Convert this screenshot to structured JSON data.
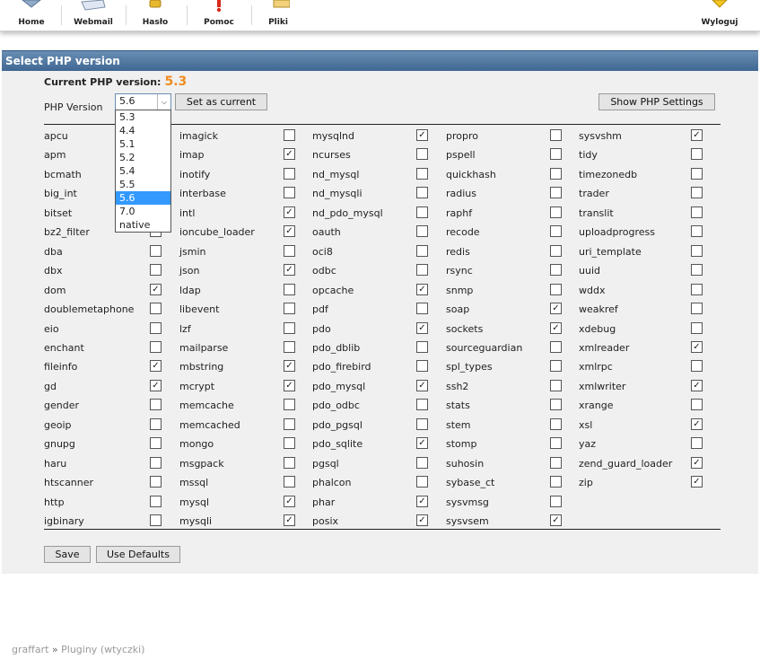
{
  "nav": {
    "items": [
      {
        "label": "Home",
        "icon": "home-icon"
      },
      {
        "label": "Webmail",
        "icon": "mail-icon"
      },
      {
        "label": "Hasło",
        "icon": "key-icon"
      },
      {
        "label": "Pomoc",
        "icon": "help-icon"
      },
      {
        "label": "Pliki",
        "icon": "files-icon"
      }
    ],
    "logout": "Wyloguj"
  },
  "panel": {
    "title": "Select PHP version",
    "current_label": "Current PHP version:",
    "current_value": "5.3",
    "version_label": "PHP Version",
    "selected_version": "5.6",
    "set_current": "Set as current",
    "show_settings": "Show PHP Settings",
    "save": "Save",
    "defaults": "Use Defaults"
  },
  "dropdown": {
    "options": [
      "5.3",
      "4.4",
      "5.1",
      "5.2",
      "5.4",
      "5.5",
      "5.6",
      "7.0",
      "native"
    ],
    "highlighted": "5.6"
  },
  "extensions": [
    [
      {
        "name": "apcu",
        "checked": false
      },
      {
        "name": "apm",
        "checked": false
      },
      {
        "name": "bcmath",
        "checked": false
      },
      {
        "name": "big_int",
        "checked": false
      },
      {
        "name": "bitset",
        "checked": false
      },
      {
        "name": "bz2_filter",
        "checked": false
      },
      {
        "name": "dba",
        "checked": false
      },
      {
        "name": "dbx",
        "checked": false
      },
      {
        "name": "dom",
        "checked": true
      },
      {
        "name": "doublemetaphone",
        "checked": false
      },
      {
        "name": "eio",
        "checked": false
      },
      {
        "name": "enchant",
        "checked": false
      },
      {
        "name": "fileinfo",
        "checked": true
      },
      {
        "name": "gd",
        "checked": true
      },
      {
        "name": "gender",
        "checked": false
      },
      {
        "name": "geoip",
        "checked": false
      },
      {
        "name": "gnupg",
        "checked": false
      },
      {
        "name": "haru",
        "checked": false
      },
      {
        "name": "htscanner",
        "checked": false
      },
      {
        "name": "http",
        "checked": false
      },
      {
        "name": "igbinary",
        "checked": false
      }
    ],
    [
      {
        "name": "imagick",
        "checked": false
      },
      {
        "name": "imap",
        "checked": true
      },
      {
        "name": "inotify",
        "checked": false
      },
      {
        "name": "interbase",
        "checked": false
      },
      {
        "name": "intl",
        "checked": true
      },
      {
        "name": "ioncube_loader",
        "checked": true
      },
      {
        "name": "jsmin",
        "checked": false
      },
      {
        "name": "json",
        "checked": true
      },
      {
        "name": "ldap",
        "checked": false
      },
      {
        "name": "libevent",
        "checked": false
      },
      {
        "name": "lzf",
        "checked": false
      },
      {
        "name": "mailparse",
        "checked": false
      },
      {
        "name": "mbstring",
        "checked": true
      },
      {
        "name": "mcrypt",
        "checked": true
      },
      {
        "name": "memcache",
        "checked": false
      },
      {
        "name": "memcached",
        "checked": false
      },
      {
        "name": "mongo",
        "checked": false
      },
      {
        "name": "msgpack",
        "checked": false
      },
      {
        "name": "mssql",
        "checked": false
      },
      {
        "name": "mysql",
        "checked": true
      },
      {
        "name": "mysqli",
        "checked": true
      }
    ],
    [
      {
        "name": "mysqlnd",
        "checked": true
      },
      {
        "name": "ncurses",
        "checked": false
      },
      {
        "name": "nd_mysql",
        "checked": false
      },
      {
        "name": "nd_mysqli",
        "checked": false
      },
      {
        "name": "nd_pdo_mysql",
        "checked": false
      },
      {
        "name": "oauth",
        "checked": false
      },
      {
        "name": "oci8",
        "checked": false
      },
      {
        "name": "odbc",
        "checked": false
      },
      {
        "name": "opcache",
        "checked": true
      },
      {
        "name": "pdf",
        "checked": false
      },
      {
        "name": "pdo",
        "checked": true
      },
      {
        "name": "pdo_dblib",
        "checked": false
      },
      {
        "name": "pdo_firebird",
        "checked": false
      },
      {
        "name": "pdo_mysql",
        "checked": true
      },
      {
        "name": "pdo_odbc",
        "checked": false
      },
      {
        "name": "pdo_pgsql",
        "checked": false
      },
      {
        "name": "pdo_sqlite",
        "checked": true
      },
      {
        "name": "pgsql",
        "checked": false
      },
      {
        "name": "phalcon",
        "checked": false
      },
      {
        "name": "phar",
        "checked": true
      },
      {
        "name": "posix",
        "checked": true
      }
    ],
    [
      {
        "name": "propro",
        "checked": false
      },
      {
        "name": "pspell",
        "checked": false
      },
      {
        "name": "quickhash",
        "checked": false
      },
      {
        "name": "radius",
        "checked": false
      },
      {
        "name": "raphf",
        "checked": false
      },
      {
        "name": "recode",
        "checked": false
      },
      {
        "name": "redis",
        "checked": false
      },
      {
        "name": "rsync",
        "checked": false
      },
      {
        "name": "snmp",
        "checked": false
      },
      {
        "name": "soap",
        "checked": true
      },
      {
        "name": "sockets",
        "checked": true
      },
      {
        "name": "sourceguardian",
        "checked": false
      },
      {
        "name": "spl_types",
        "checked": false
      },
      {
        "name": "ssh2",
        "checked": false
      },
      {
        "name": "stats",
        "checked": false
      },
      {
        "name": "stem",
        "checked": false
      },
      {
        "name": "stomp",
        "checked": false
      },
      {
        "name": "suhosin",
        "checked": false
      },
      {
        "name": "sybase_ct",
        "checked": false
      },
      {
        "name": "sysvmsg",
        "checked": false
      },
      {
        "name": "sysvsem",
        "checked": true
      }
    ],
    [
      {
        "name": "sysvshm",
        "checked": true
      },
      {
        "name": "tidy",
        "checked": false
      },
      {
        "name": "timezonedb",
        "checked": false
      },
      {
        "name": "trader",
        "checked": false
      },
      {
        "name": "translit",
        "checked": false
      },
      {
        "name": "uploadprogress",
        "checked": false
      },
      {
        "name": "uri_template",
        "checked": false
      },
      {
        "name": "uuid",
        "checked": false
      },
      {
        "name": "wddx",
        "checked": false
      },
      {
        "name": "weakref",
        "checked": false
      },
      {
        "name": "xdebug",
        "checked": false
      },
      {
        "name": "xmlreader",
        "checked": true
      },
      {
        "name": "xmlrpc",
        "checked": false
      },
      {
        "name": "xmlwriter",
        "checked": true
      },
      {
        "name": "xrange",
        "checked": false
      },
      {
        "name": "xsl",
        "checked": true
      },
      {
        "name": "yaz",
        "checked": false
      },
      {
        "name": "zend_guard_loader",
        "checked": true
      },
      {
        "name": "zip",
        "checked": true
      }
    ]
  ],
  "breadcrumb": {
    "root": "graffart",
    "separator": "»",
    "current": "Pluginy (wtyczki)"
  }
}
